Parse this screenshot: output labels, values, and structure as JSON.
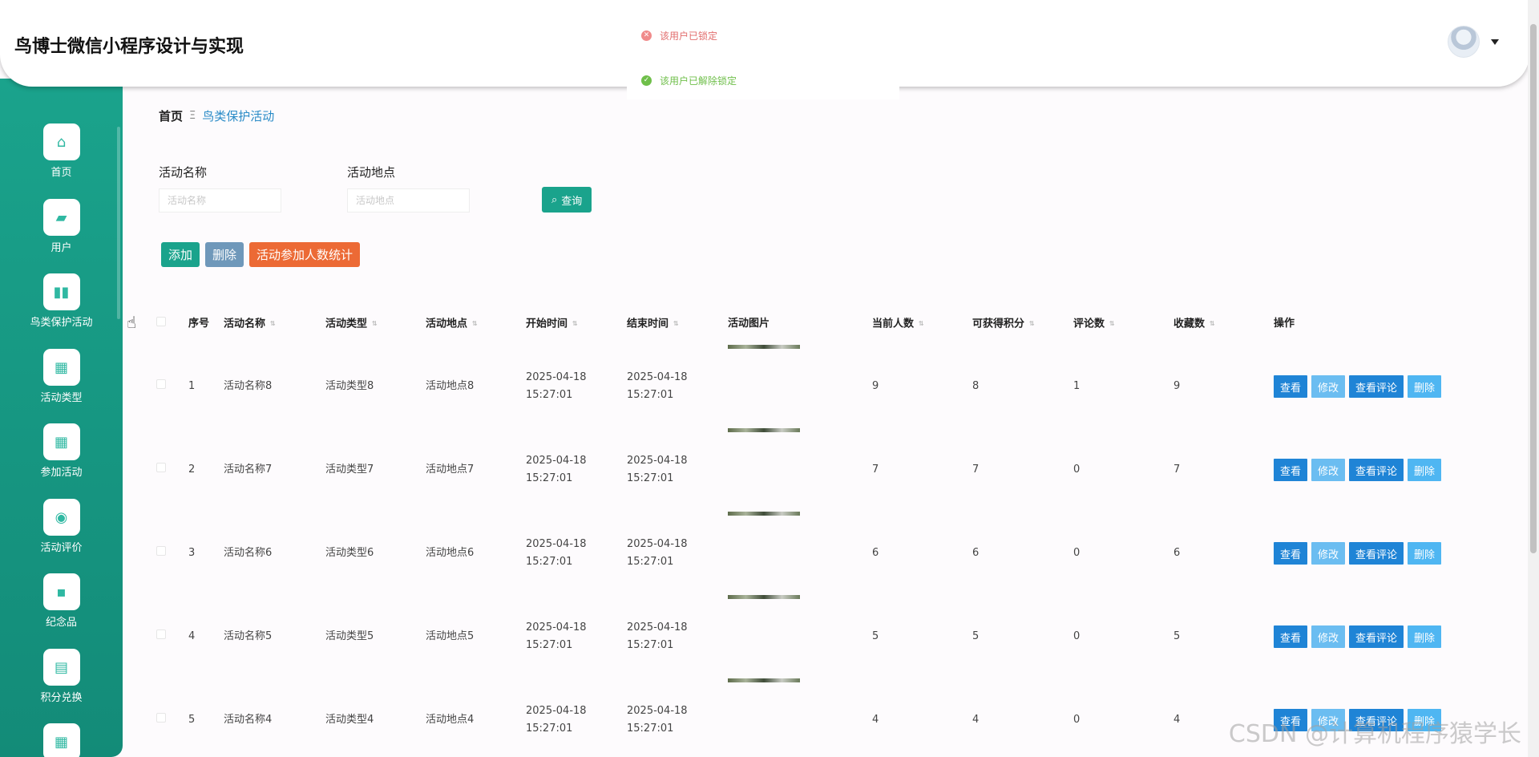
{
  "app": {
    "title": "鸟博士微信小程序设计与实现"
  },
  "notifications": [
    {
      "type": "error",
      "text": "该用户已锁定"
    },
    {
      "type": "success",
      "text": "该用户已解除锁定"
    }
  ],
  "sidebar": {
    "items": [
      {
        "label": "首页",
        "icon": "home-icon"
      },
      {
        "label": "用户",
        "icon": "briefcase-icon"
      },
      {
        "label": "鸟类保护活动",
        "icon": "ticket-icon"
      },
      {
        "label": "活动类型",
        "icon": "grid-icon"
      },
      {
        "label": "参加活动",
        "icon": "grid-icon"
      },
      {
        "label": "活动评价",
        "icon": "user-badge-icon"
      },
      {
        "label": "纪念品",
        "icon": "chat-icon"
      },
      {
        "label": "积分兑换",
        "icon": "clipboard-icon"
      },
      {
        "label": "",
        "icon": "grid-icon"
      }
    ]
  },
  "breadcrumb": {
    "home": "首页",
    "separator": "Ξ",
    "current": "鸟类保护活动"
  },
  "search": {
    "name_label": "活动名称",
    "name_placeholder": "活动名称",
    "location_label": "活动地点",
    "location_placeholder": "活动地点",
    "button": "查询"
  },
  "actions": {
    "add": "添加",
    "delete": "删除",
    "stats": "活动参加人数统计"
  },
  "table": {
    "headers": {
      "no": "序号",
      "name": "活动名称",
      "type": "活动类型",
      "location": "活动地点",
      "start": "开始时间",
      "end": "结束时间",
      "image": "活动图片",
      "current": "当前人数",
      "points": "可获得积分",
      "comments": "评论数",
      "favorites": "收藏数",
      "ops": "操作"
    },
    "op_labels": {
      "view": "查看",
      "edit": "修改",
      "comments": "查看评论",
      "delete": "删除"
    },
    "rows": [
      {
        "no": "1",
        "name": "活动名称8",
        "type": "活动类型8",
        "location": "活动地点8",
        "start": "2025-04-18 15:27:01",
        "end": "2025-04-18 15:27:01",
        "current": "9",
        "points": "8",
        "comments": "1",
        "favorites": "9"
      },
      {
        "no": "2",
        "name": "活动名称7",
        "type": "活动类型7",
        "location": "活动地点7",
        "start": "2025-04-18 15:27:01",
        "end": "2025-04-18 15:27:01",
        "current": "7",
        "points": "7",
        "comments": "0",
        "favorites": "7"
      },
      {
        "no": "3",
        "name": "活动名称6",
        "type": "活动类型6",
        "location": "活动地点6",
        "start": "2025-04-18 15:27:01",
        "end": "2025-04-18 15:27:01",
        "current": "6",
        "points": "6",
        "comments": "0",
        "favorites": "6"
      },
      {
        "no": "4",
        "name": "活动名称5",
        "type": "活动类型5",
        "location": "活动地点5",
        "start": "2025-04-18 15:27:01",
        "end": "2025-04-18 15:27:01",
        "current": "5",
        "points": "5",
        "comments": "0",
        "favorites": "5"
      },
      {
        "no": "5",
        "name": "活动名称4",
        "type": "活动类型4",
        "location": "活动地点4",
        "start": "2025-04-18 15:27:01",
        "end": "2025-04-18 15:27:01",
        "current": "4",
        "points": "4",
        "comments": "0",
        "favorites": "4"
      }
    ]
  },
  "watermark": "CSDN @计算机程序猿学长"
}
